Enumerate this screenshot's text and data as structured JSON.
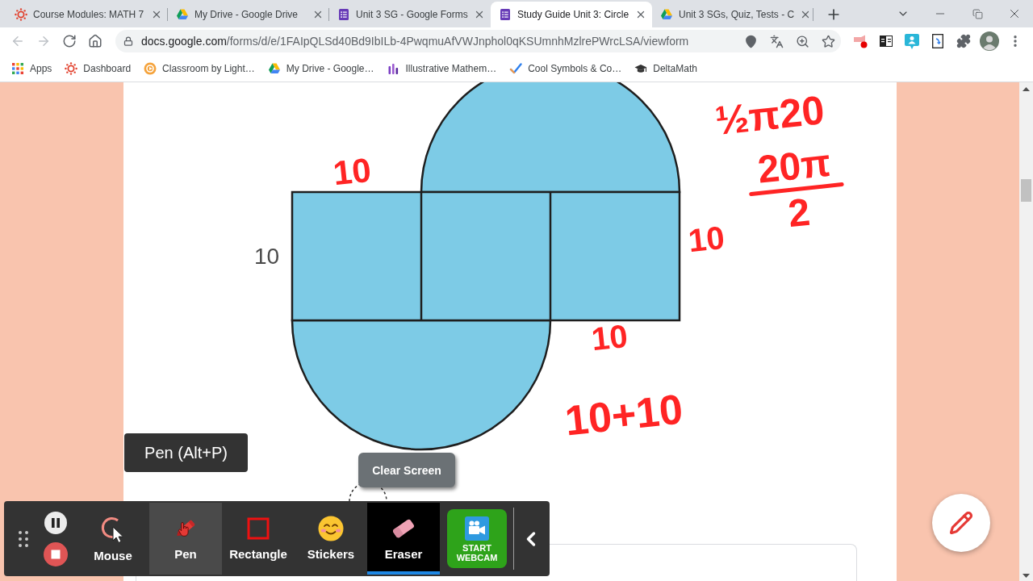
{
  "browser": {
    "tabs": [
      {
        "kind": "wheel",
        "title": "Course Modules: MATH 7",
        "selected": false
      },
      {
        "kind": "drive",
        "title": "My Drive - Google Drive",
        "selected": false
      },
      {
        "kind": "form",
        "title": "Unit 3 SG - Google Forms",
        "selected": false
      },
      {
        "kind": "form",
        "title": "Study Guide Unit 3: Circle",
        "selected": true
      },
      {
        "kind": "drive",
        "title": "Unit 3 SGs, Quiz, Tests - C",
        "selected": false
      }
    ],
    "navigation": [
      {
        "kind": "back",
        "disabled": true
      },
      {
        "kind": "forward",
        "disabled": true
      },
      {
        "kind": "reload",
        "disabled": false
      },
      {
        "kind": "home",
        "disabled": false
      }
    ],
    "address": {
      "host": "docs.google.com",
      "path": "/forms/d/e/1FAIpQLSd40Bd9IbILb-4PwqmuAfVWJnphol0qKSUmnhMzlrePWrcLSA/viewform"
    },
    "bookmarks": [
      {
        "kind": "grid",
        "label": "Apps"
      },
      {
        "kind": "wheel",
        "label": "Dashboard"
      },
      {
        "kind": "ring",
        "label": "Classroom by Light…"
      },
      {
        "kind": "drive",
        "label": "My Drive - Google…"
      },
      {
        "kind": "bars",
        "label": "Illustrative Mathem…"
      },
      {
        "kind": "tick",
        "label": "Cool Symbols & Co…"
      },
      {
        "kind": "cap",
        "label": "DeltaMath"
      }
    ]
  },
  "question": {
    "figure": {
      "side_label": "10"
    }
  },
  "annotations": [
    {
      "kind": "text",
      "text": "10"
    },
    {
      "kind": "text",
      "text": "½π20"
    },
    {
      "kind": "fraction",
      "numerator": "20π",
      "denominator": "2"
    },
    {
      "kind": "text",
      "text": "10"
    },
    {
      "kind": "text",
      "text": "10"
    },
    {
      "kind": "text",
      "text": "10+10"
    }
  ],
  "screen_recorder": {
    "tooltip": "Pen (Alt+P)",
    "clear_button": "Clear Screen",
    "tools": [
      {
        "kind": "mouse",
        "label": "Mouse",
        "selected": false,
        "hovered": false
      },
      {
        "kind": "pen",
        "label": "Pen",
        "selected": false,
        "hovered": true
      },
      {
        "kind": "rectangle",
        "label": "Rectangle",
        "selected": false,
        "hovered": false
      },
      {
        "kind": "stickers",
        "label": "Stickers",
        "selected": false,
        "hovered": false
      },
      {
        "kind": "eraser",
        "label": "Eraser",
        "selected": true,
        "hovered": false
      }
    ],
    "webcam_button": "START WEBCAM"
  }
}
